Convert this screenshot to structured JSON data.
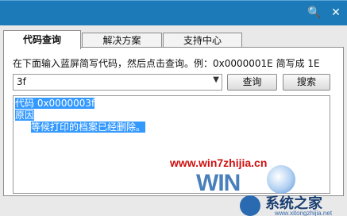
{
  "titlebar": {
    "search_glyph": "🔍",
    "close_glyph": "✕"
  },
  "tabs": [
    {
      "label": "代码查询",
      "active": true
    },
    {
      "label": "解决方案",
      "active": false
    },
    {
      "label": "支持中心",
      "active": false
    }
  ],
  "form": {
    "instruction": "在下面输入蓝屏简写代码，然后点击查询。例：0x0000001E 简写成 1E",
    "code_value": "3f",
    "query_button": "查询",
    "search_button": "搜索"
  },
  "result": {
    "line1": "代码 0x0000003f",
    "line2": "原因",
    "line3": "等候打印的档案已经删除。"
  },
  "watermark": {
    "url": "www.win7zhijia.cn",
    "logo_text": "WIN",
    "site_name": "系统之家",
    "site_url": "www.xitongzhijia.net"
  }
}
